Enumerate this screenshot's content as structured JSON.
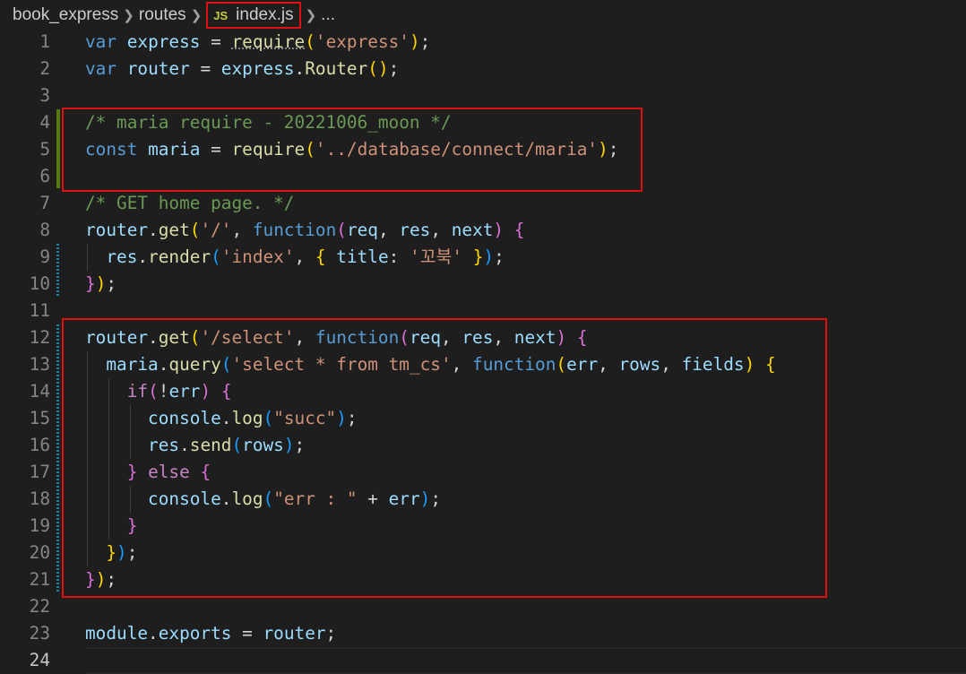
{
  "breadcrumb": {
    "items": [
      "book_express",
      "routes"
    ],
    "file_icon": "JS",
    "file_name": "index.js",
    "more": "..."
  },
  "editor": {
    "active_line": 24,
    "lines": [
      {
        "n": "1",
        "tokens": [
          [
            "kw",
            "var"
          ],
          [
            "p",
            " "
          ],
          [
            "v",
            "express"
          ],
          [
            "p",
            " = "
          ],
          [
            "fn req",
            "require"
          ],
          [
            "b1",
            "("
          ],
          [
            "str",
            "'express'"
          ],
          [
            "b1",
            ")"
          ],
          [
            "p",
            ";"
          ]
        ]
      },
      {
        "n": "2",
        "tokens": [
          [
            "kw",
            "var"
          ],
          [
            "p",
            " "
          ],
          [
            "v",
            "router"
          ],
          [
            "p",
            " = "
          ],
          [
            "v",
            "express"
          ],
          [
            "p",
            "."
          ],
          [
            "fn",
            "Router"
          ],
          [
            "b1",
            "()"
          ],
          [
            "p",
            ";"
          ]
        ]
      },
      {
        "n": "3",
        "tokens": []
      },
      {
        "n": "4",
        "tokens": [
          [
            "cm",
            "/* maria require - 20221006_moon */"
          ]
        ]
      },
      {
        "n": "5",
        "tokens": [
          [
            "kw",
            "const"
          ],
          [
            "p",
            " "
          ],
          [
            "v",
            "maria"
          ],
          [
            "p",
            " = "
          ],
          [
            "fn",
            "require"
          ],
          [
            "b1",
            "("
          ],
          [
            "str",
            "'../database/connect/maria'"
          ],
          [
            "b1",
            ")"
          ],
          [
            "p",
            ";"
          ]
        ]
      },
      {
        "n": "6",
        "tokens": []
      },
      {
        "n": "7",
        "tokens": [
          [
            "cm",
            "/* GET home page. */"
          ]
        ]
      },
      {
        "n": "8",
        "tokens": [
          [
            "v",
            "router"
          ],
          [
            "p",
            "."
          ],
          [
            "fn",
            "get"
          ],
          [
            "b1",
            "("
          ],
          [
            "str",
            "'/'"
          ],
          [
            "p",
            ", "
          ],
          [
            "kw",
            "function"
          ],
          [
            "b2",
            "("
          ],
          [
            "v",
            "req"
          ],
          [
            "p",
            ", "
          ],
          [
            "v",
            "res"
          ],
          [
            "p",
            ", "
          ],
          [
            "v",
            "next"
          ],
          [
            "b2",
            ")"
          ],
          [
            "p",
            " "
          ],
          [
            "b2",
            "{"
          ]
        ]
      },
      {
        "n": "9",
        "tokens": [
          [
            "p",
            "  "
          ],
          [
            "v",
            "res"
          ],
          [
            "p",
            "."
          ],
          [
            "fn",
            "render"
          ],
          [
            "b3",
            "("
          ],
          [
            "str",
            "'index'"
          ],
          [
            "p",
            ", "
          ],
          [
            "b1",
            "{"
          ],
          [
            "p",
            " "
          ],
          [
            "v",
            "title"
          ],
          [
            "p",
            ": "
          ],
          [
            "str",
            "'꼬북'"
          ],
          [
            "p",
            " "
          ],
          [
            "b1",
            "}"
          ],
          [
            "b3",
            ")"
          ],
          [
            "p",
            ";"
          ]
        ]
      },
      {
        "n": "10",
        "tokens": [
          [
            "b2",
            "}"
          ],
          [
            "b1",
            ")"
          ],
          [
            "p",
            ";"
          ]
        ]
      },
      {
        "n": "11",
        "tokens": []
      },
      {
        "n": "12",
        "tokens": [
          [
            "v",
            "router"
          ],
          [
            "p",
            "."
          ],
          [
            "fn",
            "get"
          ],
          [
            "b1",
            "("
          ],
          [
            "str",
            "'/select'"
          ],
          [
            "p",
            ", "
          ],
          [
            "kw",
            "function"
          ],
          [
            "b2",
            "("
          ],
          [
            "v",
            "req"
          ],
          [
            "p",
            ", "
          ],
          [
            "v",
            "res"
          ],
          [
            "p",
            ", "
          ],
          [
            "v",
            "next"
          ],
          [
            "b2",
            ")"
          ],
          [
            "p",
            " "
          ],
          [
            "b2",
            "{"
          ]
        ]
      },
      {
        "n": "13",
        "tokens": [
          [
            "p",
            "  "
          ],
          [
            "v",
            "maria"
          ],
          [
            "p",
            "."
          ],
          [
            "fn",
            "query"
          ],
          [
            "b3",
            "("
          ],
          [
            "str",
            "'select * from tm_cs'"
          ],
          [
            "p",
            ", "
          ],
          [
            "kw",
            "function"
          ],
          [
            "b1",
            "("
          ],
          [
            "v",
            "err"
          ],
          [
            "p",
            ", "
          ],
          [
            "v",
            "rows"
          ],
          [
            "p",
            ", "
          ],
          [
            "v",
            "fields"
          ],
          [
            "b1",
            ")"
          ],
          [
            "p",
            " "
          ],
          [
            "b1",
            "{"
          ]
        ]
      },
      {
        "n": "14",
        "tokens": [
          [
            "p",
            "    "
          ],
          [
            "ctl",
            "if"
          ],
          [
            "b2",
            "("
          ],
          [
            "p",
            "!"
          ],
          [
            "v",
            "err"
          ],
          [
            "b2",
            ")"
          ],
          [
            "p",
            " "
          ],
          [
            "b2",
            "{"
          ]
        ]
      },
      {
        "n": "15",
        "tokens": [
          [
            "p",
            "      "
          ],
          [
            "v",
            "console"
          ],
          [
            "p",
            "."
          ],
          [
            "fn",
            "log"
          ],
          [
            "b3",
            "("
          ],
          [
            "str",
            "\"succ\""
          ],
          [
            "b3",
            ")"
          ],
          [
            "p",
            ";"
          ]
        ]
      },
      {
        "n": "16",
        "tokens": [
          [
            "p",
            "      "
          ],
          [
            "v",
            "res"
          ],
          [
            "p",
            "."
          ],
          [
            "fn",
            "send"
          ],
          [
            "b3",
            "("
          ],
          [
            "v",
            "rows"
          ],
          [
            "b3",
            ")"
          ],
          [
            "p",
            ";"
          ]
        ]
      },
      {
        "n": "17",
        "tokens": [
          [
            "p",
            "    "
          ],
          [
            "b2",
            "}"
          ],
          [
            "p",
            " "
          ],
          [
            "ctl",
            "else"
          ],
          [
            "p",
            " "
          ],
          [
            "b2",
            "{"
          ]
        ]
      },
      {
        "n": "18",
        "tokens": [
          [
            "p",
            "      "
          ],
          [
            "v",
            "console"
          ],
          [
            "p",
            "."
          ],
          [
            "fn",
            "log"
          ],
          [
            "b3",
            "("
          ],
          [
            "str",
            "\"err : \""
          ],
          [
            "p",
            " + "
          ],
          [
            "v",
            "err"
          ],
          [
            "b3",
            ")"
          ],
          [
            "p",
            ";"
          ]
        ]
      },
      {
        "n": "19",
        "tokens": [
          [
            "p",
            "    "
          ],
          [
            "b2",
            "}"
          ]
        ]
      },
      {
        "n": "20",
        "tokens": [
          [
            "p",
            "  "
          ],
          [
            "b1",
            "}"
          ],
          [
            "b3",
            ")"
          ],
          [
            "p",
            ";"
          ]
        ]
      },
      {
        "n": "21",
        "tokens": [
          [
            "b2",
            "}"
          ],
          [
            "b1",
            ")"
          ],
          [
            "p",
            ";"
          ]
        ]
      },
      {
        "n": "22",
        "tokens": []
      },
      {
        "n": "23",
        "tokens": [
          [
            "v",
            "module"
          ],
          [
            "p",
            "."
          ],
          [
            "v",
            "exports"
          ],
          [
            "p",
            " = "
          ],
          [
            "v",
            "router"
          ],
          [
            "p",
            ";"
          ]
        ]
      },
      {
        "n": "24",
        "tokens": []
      }
    ]
  },
  "colors": {
    "background": "#1e1e1e",
    "highlight_box": "#e01010",
    "gutter_added": "#587c0c",
    "gutter_modified": "#1b81a8"
  }
}
